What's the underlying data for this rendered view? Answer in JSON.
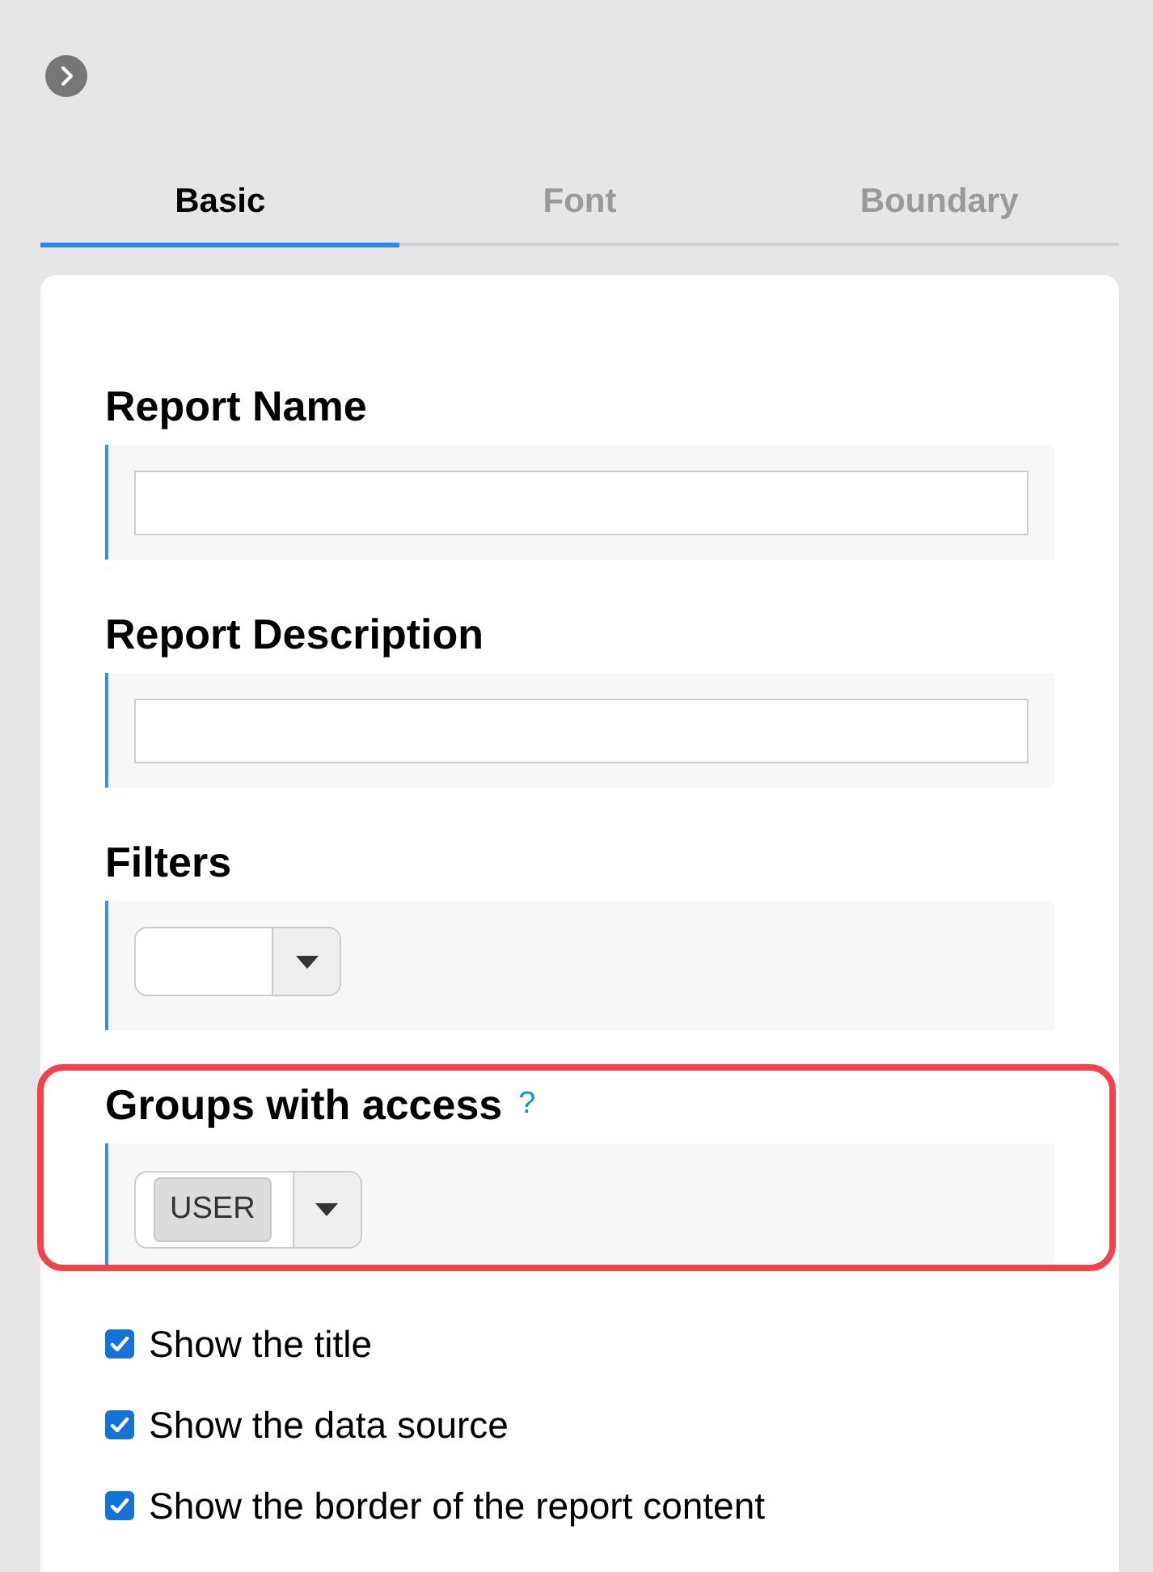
{
  "tabs": [
    {
      "label": "Basic",
      "selected": true
    },
    {
      "label": "Font",
      "selected": false
    },
    {
      "label": "Boundary",
      "selected": false
    }
  ],
  "fields": [
    {
      "kind": "text",
      "label": "Report Name",
      "highlighted": false
    },
    {
      "kind": "text",
      "label": "Report Description",
      "highlighted": false
    },
    {
      "kind": "select",
      "label": "Filters",
      "highlighted": false
    },
    {
      "kind": "select",
      "label": "Groups with access",
      "help": "?",
      "tags": [
        "USER"
      ],
      "highlighted": true
    }
  ],
  "options": [
    {
      "label": "Show the title",
      "checked": true
    },
    {
      "label": "Show the data source",
      "checked": true
    },
    {
      "label": "Show the border of the report content",
      "checked": true
    }
  ]
}
